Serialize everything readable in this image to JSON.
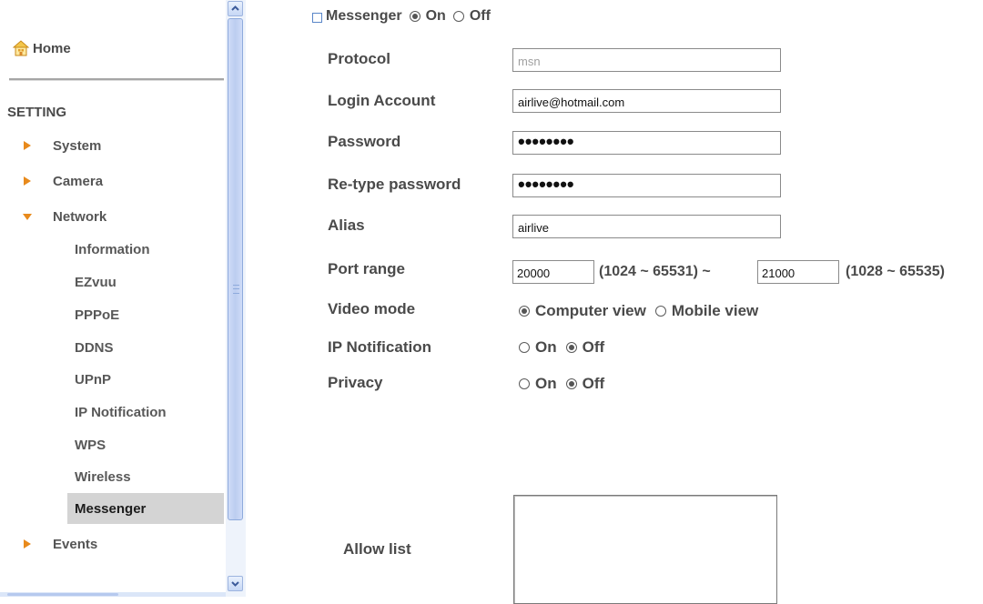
{
  "sidebar": {
    "home_label": "Home",
    "section_label": "SETTING",
    "top_items": [
      {
        "label": "System",
        "expanded": false
      },
      {
        "label": "Camera",
        "expanded": false
      },
      {
        "label": "Network",
        "expanded": true
      },
      {
        "label": "Events",
        "expanded": false
      }
    ],
    "network_items": [
      {
        "label": "Information"
      },
      {
        "label": "EZvuu"
      },
      {
        "label": "PPPoE"
      },
      {
        "label": "DDNS"
      },
      {
        "label": "UPnP"
      },
      {
        "label": "IP Notification"
      },
      {
        "label": "WPS"
      },
      {
        "label": "Wireless"
      },
      {
        "label": "Messenger",
        "active": true
      }
    ]
  },
  "form": {
    "title": "Messenger",
    "title_on_label": "On",
    "title_off_label": "Off",
    "enabled": "on",
    "protocol_label": "Protocol",
    "protocol_value": "msn",
    "login_label": "Login Account",
    "login_value": "airlive@hotmail.com",
    "password_label": "Password",
    "password_mask": "••••••••",
    "retype_label": "Re-type password",
    "retype_mask": "••••••••",
    "alias_label": "Alias",
    "alias_value": "airlive",
    "port_label": "Port range",
    "port_start": "20000",
    "port_start_range": "(1024 ~ 65531) ~",
    "port_end": "21000",
    "port_end_range": "(1028 ~ 65535)",
    "video_label": "Video mode",
    "video_computer": "Computer view",
    "video_mobile": "Mobile view",
    "video_selected": "computer",
    "ipnotif_label": "IP Notification",
    "ipnotif_on": "On",
    "ipnotif_off": "Off",
    "ipnotif_selected": "off",
    "privacy_label": "Privacy",
    "privacy_on": "On",
    "privacy_off": "Off",
    "privacy_selected": "off",
    "allow_label": "Allow list"
  },
  "colors": {
    "text": "#4a4a4a",
    "active_bg": "#d4d4d4",
    "arrow": "#e88a1c",
    "scrollbar": "#bccdf0"
  }
}
